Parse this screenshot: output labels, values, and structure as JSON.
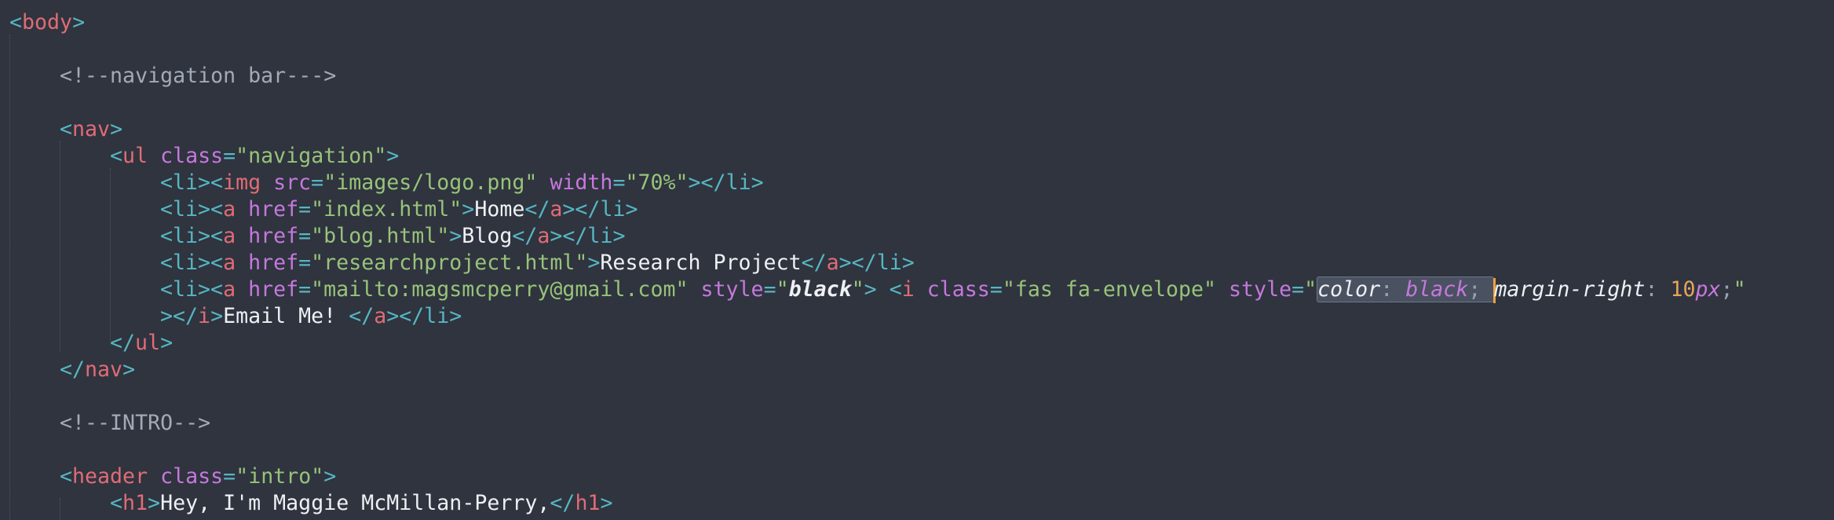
{
  "editor": {
    "language": "html",
    "theme_colors": {
      "background": "#2f343f",
      "tag": "#e06c75",
      "punctuation": "#56b6c2",
      "attribute": "#c678dd",
      "string": "#98c379",
      "text": "#eef0f4",
      "comment": "#a3aab6",
      "number": "#e5a45d",
      "cursor": "#f0a33a"
    },
    "lines": {
      "body_open": {
        "open": "<",
        "tag": "body",
        "close": ">"
      },
      "nav_comment": "<!--navigation bar--->",
      "nav_open": {
        "open": "<",
        "tag": "nav",
        "close": ">"
      },
      "ul_open": {
        "open": "<",
        "tag": "ul",
        "attr": "class",
        "eq": "=",
        "value": "\"navigation\"",
        "close": ">"
      },
      "li_logo": {
        "li_open": "<li>",
        "img_open": "<",
        "img_tag": "img",
        "src_attr": "src",
        "eq1": "=",
        "src_value": "\"images/logo.png\"",
        "width_attr": "width",
        "eq2": "=",
        "width_value": "\"70%\"",
        "img_close": ">",
        "li_close": "</li>"
      },
      "li_home": {
        "li_open": "<li>",
        "a_open": "<",
        "a_tag": "a",
        "href_attr": "href",
        "eq": "=",
        "href_value": "\"index.html\"",
        "a_gt": ">",
        "text": "Home",
        "a_close_open": "</",
        "a_close_tag": "a",
        "a_close_gt": ">",
        "li_close": "</li>"
      },
      "li_blog": {
        "li_open": "<li>",
        "a_open": "<",
        "a_tag": "a",
        "href_attr": "href",
        "eq": "=",
        "href_value": "\"blog.html\"",
        "a_gt": ">",
        "text": "Blog",
        "a_close_open": "</",
        "a_close_tag": "a",
        "a_close_gt": ">",
        "li_close": "</li>"
      },
      "li_research": {
        "li_open": "<li>",
        "a_open": "<",
        "a_tag": "a",
        "href_attr": "href",
        "eq": "=",
        "href_value": "\"researchproject.html\"",
        "a_gt": ">",
        "text": "Research Project",
        "a_close_open": "</",
        "a_close_tag": "a",
        "a_close_gt": ">",
        "li_close": "</li>"
      },
      "li_email": {
        "li_open": "<li>",
        "a_open": "<",
        "a_tag": "a",
        "href_attr": "href",
        "eq1": "=",
        "href_value": "\"mailto:magsmcperry@gmail.com\"",
        "style_attr": "style",
        "eq2": "=",
        "quote_open1": "\"",
        "style_value1": "black",
        "quote_close1": "\"",
        "a_gt": ">",
        "i_open": "<",
        "i_tag": "i",
        "class_attr": "class",
        "eq3": "=",
        "class_value": "\"fas fa-envelope\"",
        "style_attr2": "style",
        "eq4": "=",
        "quote_open2": "\"",
        "css_prop1": "color",
        "css_colon1": ": ",
        "css_value1": "black",
        "css_semi1": "; ",
        "css_prop2": "margin-right",
        "css_colon2": ": ",
        "css_num": "10",
        "css_unit": "px",
        "css_semi2": ";",
        "quote_close2": "\""
      },
      "li_email_cont": {
        "i_gt": ">",
        "i_close_open": "</",
        "i_close_tag": "i",
        "i_close_gt": ">",
        "text": "Email Me! ",
        "a_close_open": "</",
        "a_close_tag": "a",
        "a_close_gt": ">",
        "li_close": "</li>"
      },
      "ul_close": {
        "open": "</",
        "tag": "ul",
        "close": ">"
      },
      "nav_close": {
        "open": "</",
        "tag": "nav",
        "close": ">"
      },
      "intro_comment": "<!--INTRO-->",
      "header_open": {
        "open": "<",
        "tag": "header",
        "attr": "class",
        "eq": "=",
        "value": "\"intro\"",
        "close": ">"
      },
      "h1_line": {
        "open": "<",
        "tag": "h1",
        "gt": ">",
        "text": "Hey, I'm Maggie McMillan-Perry,",
        "close_open": "</",
        "close_tag": "h1",
        "close_gt": ">"
      }
    }
  }
}
